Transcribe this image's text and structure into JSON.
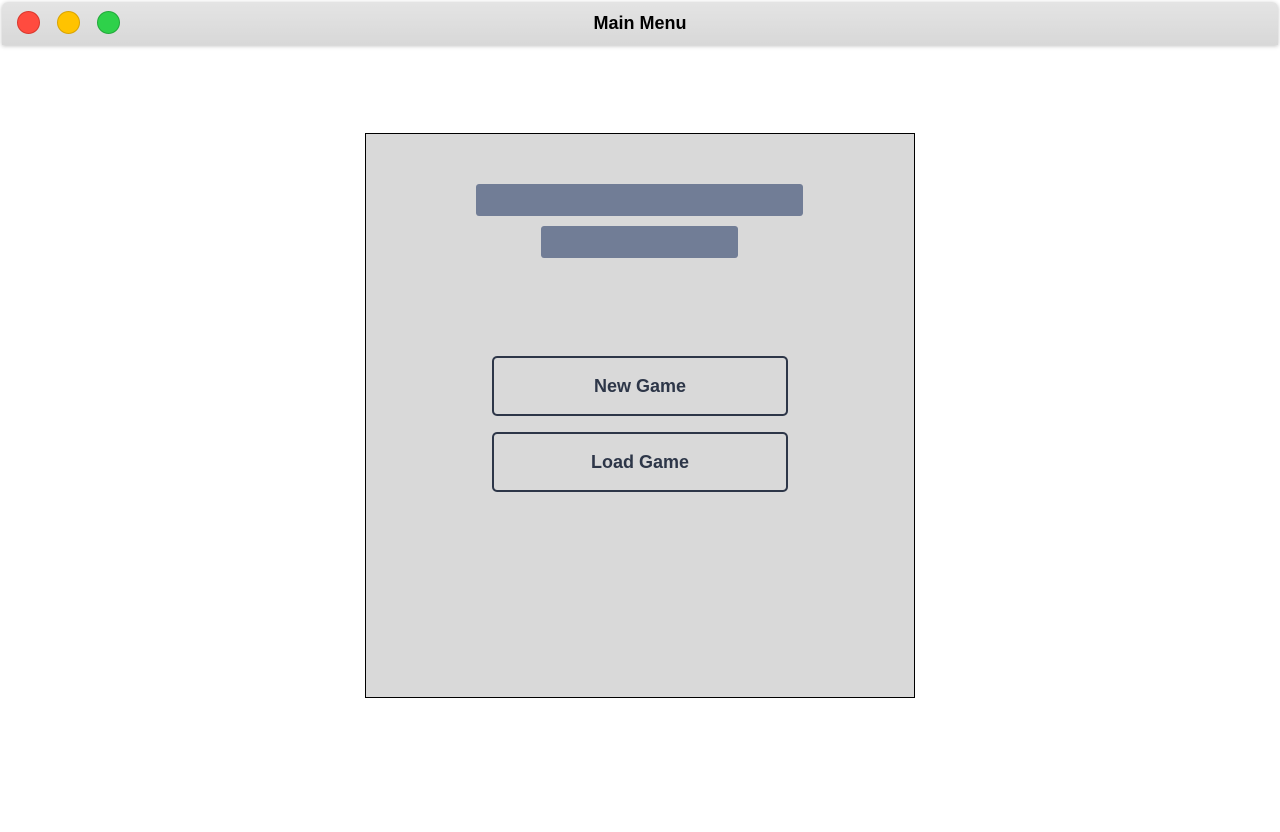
{
  "window": {
    "title": "Main Menu",
    "controls": [
      "close",
      "minimize",
      "zoom"
    ]
  },
  "menu": {
    "title_placeholder": "",
    "subtitle_placeholder": "",
    "buttons": [
      {
        "label": "New Game"
      },
      {
        "label": "Load Game"
      }
    ]
  },
  "colors": {
    "close": "#ff4b3f",
    "minimize": "#ffc300",
    "zoom": "#2ed14a",
    "panel_bg": "#d9d9d9",
    "placeholder_bar": "#717d96",
    "button_text": "#2d3648"
  }
}
